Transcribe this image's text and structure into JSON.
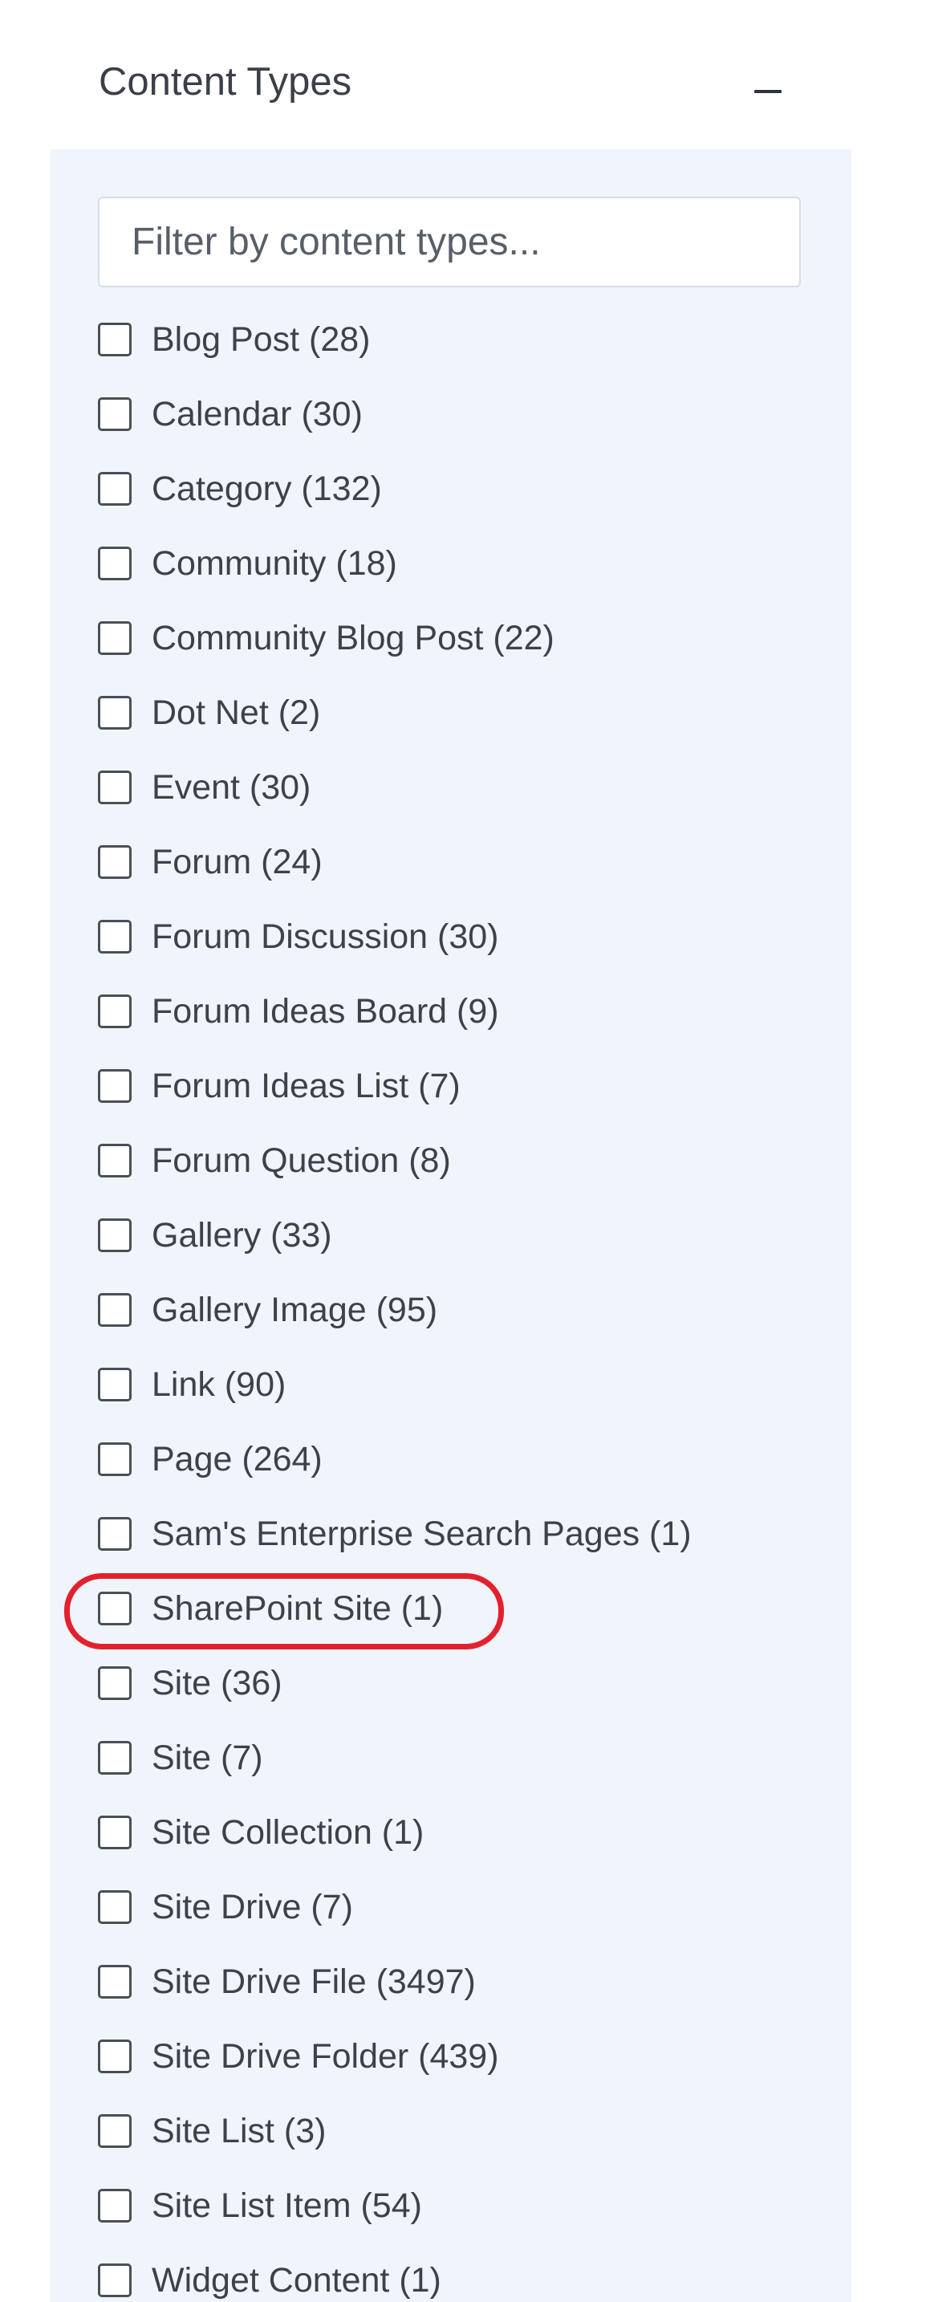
{
  "section": {
    "title": "Content Types",
    "collapse_label": "–"
  },
  "filter": {
    "placeholder": "Filter by content types...",
    "value": ""
  },
  "content_types": [
    {
      "label": "Blog Post (28)",
      "checked": false
    },
    {
      "label": "Calendar (30)",
      "checked": false
    },
    {
      "label": "Category (132)",
      "checked": false
    },
    {
      "label": "Community (18)",
      "checked": false
    },
    {
      "label": "Community Blog Post (22)",
      "checked": false
    },
    {
      "label": "Dot Net (2)",
      "checked": false
    },
    {
      "label": "Event (30)",
      "checked": false
    },
    {
      "label": "Forum (24)",
      "checked": false
    },
    {
      "label": "Forum Discussion (30)",
      "checked": false
    },
    {
      "label": "Forum Ideas Board (9)",
      "checked": false
    },
    {
      "label": "Forum Ideas List (7)",
      "checked": false
    },
    {
      "label": "Forum Question (8)",
      "checked": false
    },
    {
      "label": "Gallery (33)",
      "checked": false
    },
    {
      "label": "Gallery Image (95)",
      "checked": false
    },
    {
      "label": "Link (90)",
      "checked": false
    },
    {
      "label": "Page (264)",
      "checked": false
    },
    {
      "label": "Sam's Enterprise Search Pages (1)",
      "checked": false
    },
    {
      "label": "SharePoint Site (1)",
      "checked": false,
      "highlighted": true
    },
    {
      "label": "Site (36)",
      "checked": false
    },
    {
      "label": "Site (7)",
      "checked": false
    },
    {
      "label": "Site Collection (1)",
      "checked": false
    },
    {
      "label": "Site Drive (7)",
      "checked": false
    },
    {
      "label": "Site Drive File (3497)",
      "checked": false
    },
    {
      "label": "Site Drive Folder (439)",
      "checked": false
    },
    {
      "label": "Site List (3)",
      "checked": false
    },
    {
      "label": "Site List Item (54)",
      "checked": false
    },
    {
      "label": "Widget Content (1)",
      "checked": false
    }
  ],
  "colors": {
    "panel_background": "#f0f5fc",
    "highlight_annotation": "#e3212d"
  }
}
